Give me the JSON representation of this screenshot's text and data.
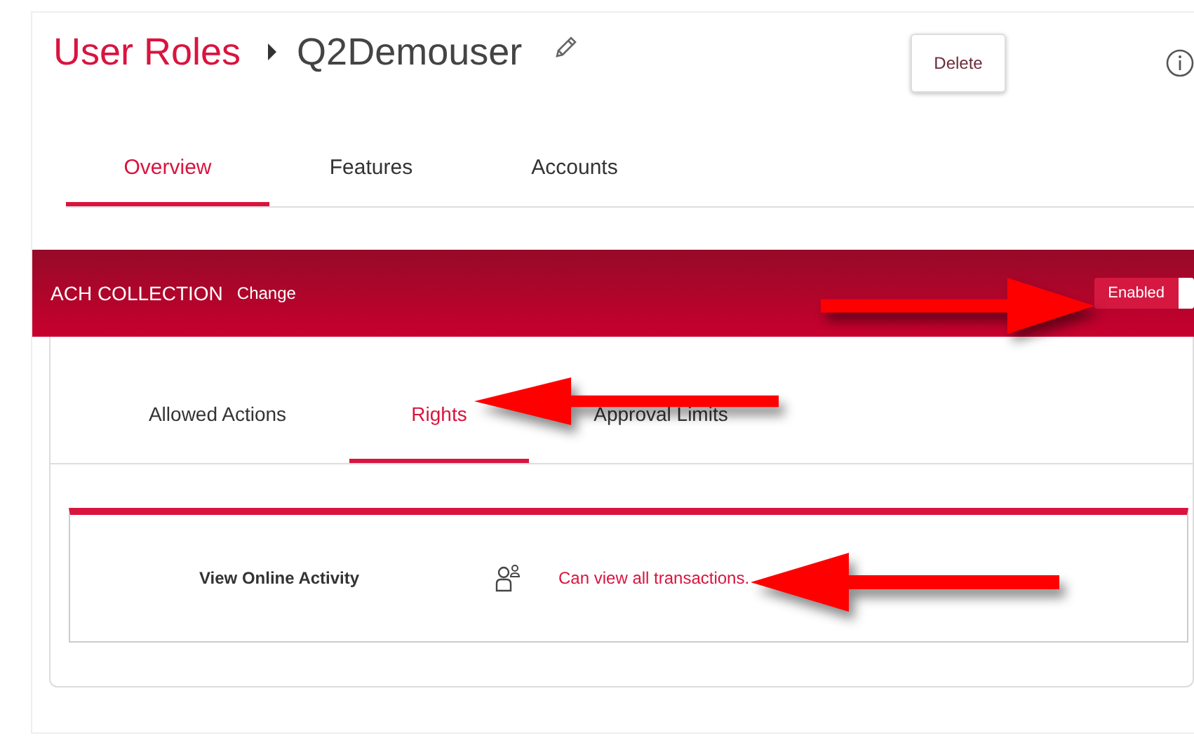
{
  "breadcrumb": {
    "parent": "User Roles",
    "current": "Q2Demouser"
  },
  "delete_button": "Delete",
  "tabs": [
    {
      "label": "Overview",
      "selected": true
    },
    {
      "label": "Features",
      "selected": false
    },
    {
      "label": "Accounts",
      "selected": false
    }
  ],
  "feature_banner": {
    "title": "ACH COLLECTION",
    "change_link": "Change",
    "toggle": {
      "label": "Enabled",
      "on": true
    }
  },
  "sub_tabs": [
    {
      "label": "Allowed Actions",
      "selected": false
    },
    {
      "label": "Rights",
      "selected": true
    },
    {
      "label": "Approval Limits",
      "selected": false
    }
  ],
  "rights": [
    {
      "name": "View Online Activity",
      "description": "Can view all transactions."
    }
  ],
  "annotations": [
    {
      "kind": "right_arrow"
    },
    {
      "kind": "left_arrow"
    },
    {
      "kind": "left_arrow"
    }
  ]
}
